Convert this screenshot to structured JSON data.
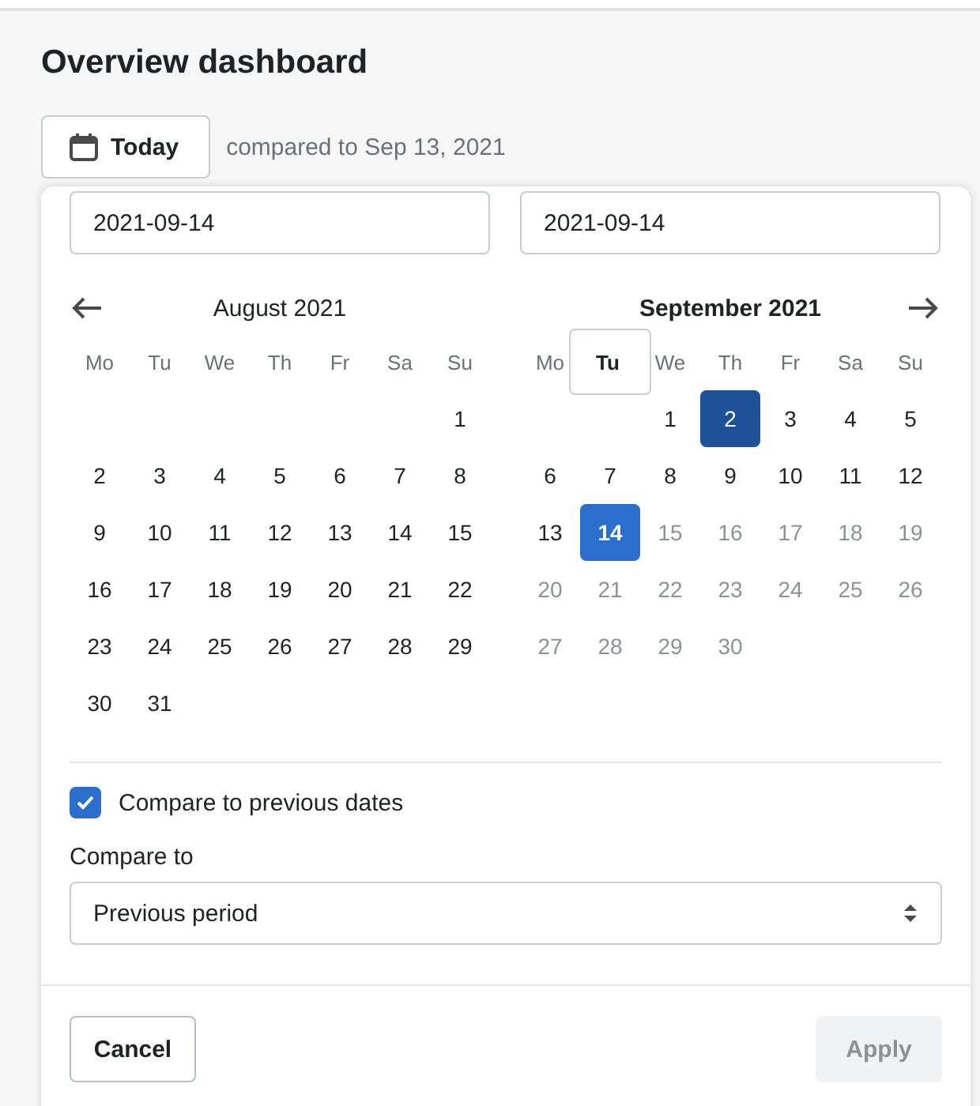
{
  "page_title": "Overview dashboard",
  "date_button": {
    "label": "Today"
  },
  "compare_text": "compared to Sep 13, 2021",
  "date_picker": {
    "start_field": {
      "value": "2021-09-14"
    },
    "end_field": {
      "value": "2021-09-14"
    },
    "months": [
      {
        "title": "August 2021",
        "current": false,
        "weekdays": [
          {
            "label": "Mo",
            "today": false
          },
          {
            "label": "Tu",
            "today": false
          },
          {
            "label": "We",
            "today": false
          },
          {
            "label": "Th",
            "today": false
          },
          {
            "label": "Fr",
            "today": false
          },
          {
            "label": "Sa",
            "today": false
          },
          {
            "label": "Su",
            "today": false
          }
        ],
        "weeks": [
          {
            "leading_gap": true,
            "days": [
              {
                "label": "1",
                "selected": false,
                "compared": false,
                "disabled": false
              }
            ]
          },
          {
            "days": [
              {
                "label": "2",
                "selected": false,
                "compared": false,
                "disabled": false
              },
              {
                "label": "3",
                "selected": false,
                "compared": false,
                "disabled": false
              },
              {
                "label": "4",
                "selected": false,
                "compared": false,
                "disabled": false
              },
              {
                "label": "5",
                "selected": false,
                "compared": false,
                "disabled": false
              },
              {
                "label": "6",
                "selected": false,
                "compared": false,
                "disabled": false
              },
              {
                "label": "7",
                "selected": false,
                "compared": false,
                "disabled": false
              },
              {
                "label": "8",
                "selected": false,
                "compared": false,
                "disabled": false
              }
            ]
          },
          {
            "days": [
              {
                "label": "9",
                "selected": false,
                "compared": false,
                "disabled": false
              },
              {
                "label": "10",
                "selected": false,
                "compared": false,
                "disabled": false
              },
              {
                "label": "11",
                "selected": false,
                "compared": false,
                "disabled": false
              },
              {
                "label": "12",
                "selected": false,
                "compared": false,
                "disabled": false
              },
              {
                "label": "13",
                "selected": false,
                "compared": false,
                "disabled": false
              },
              {
                "label": "14",
                "selected": false,
                "compared": false,
                "disabled": false
              },
              {
                "label": "15",
                "selected": false,
                "compared": false,
                "disabled": false
              }
            ]
          },
          {
            "days": [
              {
                "label": "16",
                "selected": false,
                "compared": false,
                "disabled": false
              },
              {
                "label": "17",
                "selected": false,
                "compared": false,
                "disabled": false
              },
              {
                "label": "18",
                "selected": false,
                "compared": false,
                "disabled": false
              },
              {
                "label": "19",
                "selected": false,
                "compared": false,
                "disabled": false
              },
              {
                "label": "20",
                "selected": false,
                "compared": false,
                "disabled": false
              },
              {
                "label": "21",
                "selected": false,
                "compared": false,
                "disabled": false
              },
              {
                "label": "22",
                "selected": false,
                "compared": false,
                "disabled": false
              }
            ]
          },
          {
            "days": [
              {
                "label": "23",
                "selected": false,
                "compared": false,
                "disabled": false
              },
              {
                "label": "24",
                "selected": false,
                "compared": false,
                "disabled": false
              },
              {
                "label": "25",
                "selected": false,
                "compared": false,
                "disabled": false
              },
              {
                "label": "26",
                "selected": false,
                "compared": false,
                "disabled": false
              },
              {
                "label": "27",
                "selected": false,
                "compared": false,
                "disabled": false
              },
              {
                "label": "28",
                "selected": false,
                "compared": false,
                "disabled": false
              },
              {
                "label": "29",
                "selected": false,
                "compared": false,
                "disabled": false
              }
            ]
          },
          {
            "days": [
              {
                "label": "30",
                "selected": false,
                "compared": false,
                "disabled": false
              },
              {
                "label": "31",
                "selected": false,
                "compared": false,
                "disabled": false
              }
            ]
          }
        ]
      },
      {
        "title": "September 2021",
        "current": true,
        "weekdays": [
          {
            "label": "Mo",
            "today": false
          },
          {
            "label": "Tu",
            "today": true
          },
          {
            "label": "We",
            "today": false
          },
          {
            "label": "Th",
            "today": false
          },
          {
            "label": "Fr",
            "today": false
          },
          {
            "label": "Sa",
            "today": false
          },
          {
            "label": "Su",
            "today": false
          }
        ],
        "weeks": [
          {
            "leading_gap": true,
            "days": [
              {
                "label": "1",
                "selected": false,
                "compared": false,
                "disabled": false
              },
              {
                "label": "2",
                "selected": false,
                "compared": true,
                "disabled": false
              },
              {
                "label": "3",
                "selected": false,
                "compared": false,
                "disabled": false
              },
              {
                "label": "4",
                "selected": false,
                "compared": false,
                "disabled": false
              },
              {
                "label": "5",
                "selected": false,
                "compared": false,
                "disabled": false
              }
            ]
          },
          {
            "days": [
              {
                "label": "6",
                "selected": false,
                "compared": false,
                "disabled": false
              },
              {
                "label": "7",
                "selected": false,
                "compared": false,
                "disabled": false
              },
              {
                "label": "8",
                "selected": false,
                "compared": false,
                "disabled": false
              },
              {
                "label": "9",
                "selected": false,
                "compared": false,
                "disabled": false
              },
              {
                "label": "10",
                "selected": false,
                "compared": false,
                "disabled": false
              },
              {
                "label": "11",
                "selected": false,
                "compared": false,
                "disabled": false
              },
              {
                "label": "12",
                "selected": false,
                "compared": false,
                "disabled": false
              }
            ]
          },
          {
            "days": [
              {
                "label": "13",
                "selected": false,
                "compared": false,
                "disabled": false
              },
              {
                "label": "14",
                "selected": true,
                "compared": false,
                "disabled": false
              },
              {
                "label": "15",
                "selected": false,
                "compared": false,
                "disabled": true
              },
              {
                "label": "16",
                "selected": false,
                "compared": false,
                "disabled": true
              },
              {
                "label": "17",
                "selected": false,
                "compared": false,
                "disabled": true
              },
              {
                "label": "18",
                "selected": false,
                "compared": false,
                "disabled": true
              },
              {
                "label": "19",
                "selected": false,
                "compared": false,
                "disabled": true
              }
            ]
          },
          {
            "days": [
              {
                "label": "20",
                "selected": false,
                "compared": false,
                "disabled": true
              },
              {
                "label": "21",
                "selected": false,
                "compared": false,
                "disabled": true
              },
              {
                "label": "22",
                "selected": false,
                "compared": false,
                "disabled": true
              },
              {
                "label": "23",
                "selected": false,
                "compared": false,
                "disabled": true
              },
              {
                "label": "24",
                "selected": false,
                "compared": false,
                "disabled": true
              },
              {
                "label": "25",
                "selected": false,
                "compared": false,
                "disabled": true
              },
              {
                "label": "26",
                "selected": false,
                "compared": false,
                "disabled": true
              }
            ]
          },
          {
            "days": [
              {
                "label": "27",
                "selected": false,
                "compared": false,
                "disabled": true
              },
              {
                "label": "28",
                "selected": false,
                "compared": false,
                "disabled": true
              },
              {
                "label": "29",
                "selected": false,
                "compared": false,
                "disabled": true
              },
              {
                "label": "30",
                "selected": false,
                "compared": false,
                "disabled": true
              }
            ]
          }
        ]
      }
    ],
    "compare_checkbox": {
      "label": "Compare to previous dates",
      "checked": true
    },
    "compare_select": {
      "label": "Compare to",
      "value": "Previous period"
    },
    "buttons": [
      {
        "label": "Cancel",
        "kind": "secondary",
        "disabled": false
      },
      {
        "label": "Apply",
        "kind": "primary",
        "disabled": true
      }
    ]
  }
}
